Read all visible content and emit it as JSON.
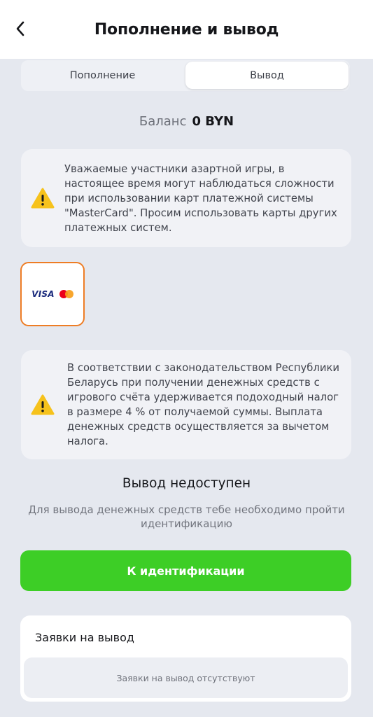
{
  "header": {
    "title": "Пополнение и вывод",
    "back_icon": "chevron-left-icon"
  },
  "tabs": [
    {
      "label": "Пополнение",
      "active": false
    },
    {
      "label": "Вывод",
      "active": true
    }
  ],
  "balance": {
    "label": "Баланс",
    "value": "0 BYN"
  },
  "notices": [
    {
      "icon": "warning-icon",
      "text": "Уважаемые участники азартной игры, в настоящее время могут наблюдаться сложности при использовании карт платежной системы \"MasterCard\". Просим использовать карты других платежных систем."
    },
    {
      "icon": "warning-icon",
      "text": "В соответствии с законодательством Республики Беларусь при получении денежных средств с игрового счёта удерживается подоходный налог в размере 4 % от получаемой суммы. Выплата денежных средств осуществляется за вычетом налога."
    }
  ],
  "payment_method": {
    "visa_label": "VISA",
    "mastercard_icon": "mastercard-logo",
    "selected": true,
    "accent_color": "#ee7d25"
  },
  "withdraw_status": {
    "title": "Вывод недоступен",
    "text": "Для вывода денежных средств тебе необходимо пройти идентификацию"
  },
  "cta": {
    "label": "К идентификации",
    "color": "#3dce26"
  },
  "requests": {
    "title": "Заявки на вывод",
    "empty_text": "Заявки на вывод отсутствуют"
  }
}
